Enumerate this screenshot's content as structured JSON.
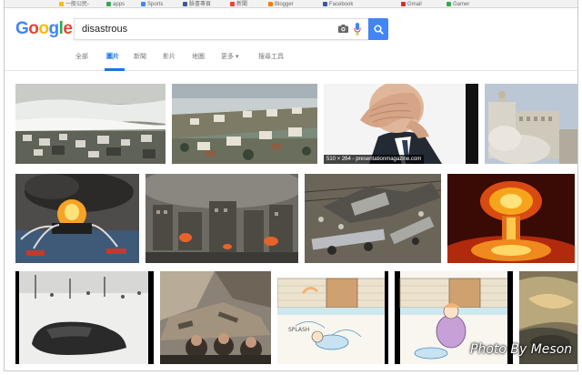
{
  "bookmarks": [
    {
      "label": "一般公民-",
      "color": "#fbbc05"
    },
    {
      "label": "apps",
      "color": "#34a853"
    },
    {
      "label": "Sports",
      "color": "#4285f4"
    },
    {
      "label": "臉書專頁",
      "color": "#3b5998"
    },
    {
      "label": "新聞",
      "color": "#ea4335"
    },
    {
      "label": "Blogger",
      "color": "#f57d00"
    },
    {
      "label": "Facebook",
      "color": "#3b5998"
    },
    {
      "label": "Gmail",
      "color": "#d93025"
    },
    {
      "label": "Gamer",
      "color": "#34a853"
    }
  ],
  "logo": {
    "letters": [
      {
        "ch": "G",
        "color": "#4285f4"
      },
      {
        "ch": "o",
        "color": "#ea4335"
      },
      {
        "ch": "o",
        "color": "#fbbc05"
      },
      {
        "ch": "g",
        "color": "#4285f4"
      },
      {
        "ch": "l",
        "color": "#34a853"
      },
      {
        "ch": "e",
        "color": "#ea4335"
      }
    ]
  },
  "search": {
    "query": "disastrous",
    "camera_icon": "camera-icon",
    "mic_icon": "mic-icon",
    "button_icon": "search-icon"
  },
  "tabs": [
    {
      "label": "全部",
      "active": false
    },
    {
      "label": "圖片",
      "active": true
    },
    {
      "label": "新聞",
      "active": false
    },
    {
      "label": "影片",
      "active": false
    },
    {
      "label": "地圖",
      "active": false
    },
    {
      "label": "更多 ▾",
      "active": false
    },
    {
      "label": "搜尋工具",
      "active": false
    }
  ],
  "results": {
    "row1": [
      {
        "name": "tsunami-flood"
      },
      {
        "name": "coastal-storm-damage"
      },
      {
        "name": "facepalm",
        "dimensions": "510 × 264 - presentationmagazine.com"
      },
      {
        "name": "building-demolition"
      }
    ],
    "row2": [
      {
        "name": "oil-rig-fire"
      },
      {
        "name": "burning-city"
      },
      {
        "name": "train-derailment"
      },
      {
        "name": "nuclear-explosion"
      }
    ],
    "row3": [
      {
        "name": "wreckage-in-snow"
      },
      {
        "name": "earthquake-rubble"
      },
      {
        "name": "cartoon-fall-1"
      },
      {
        "name": "cartoon-fall-2"
      },
      {
        "name": "dragon-fire"
      }
    ]
  },
  "watermark": "Photo By Meson",
  "colors": {
    "accent": "#1a73e8",
    "search_button": "#4285f4"
  }
}
